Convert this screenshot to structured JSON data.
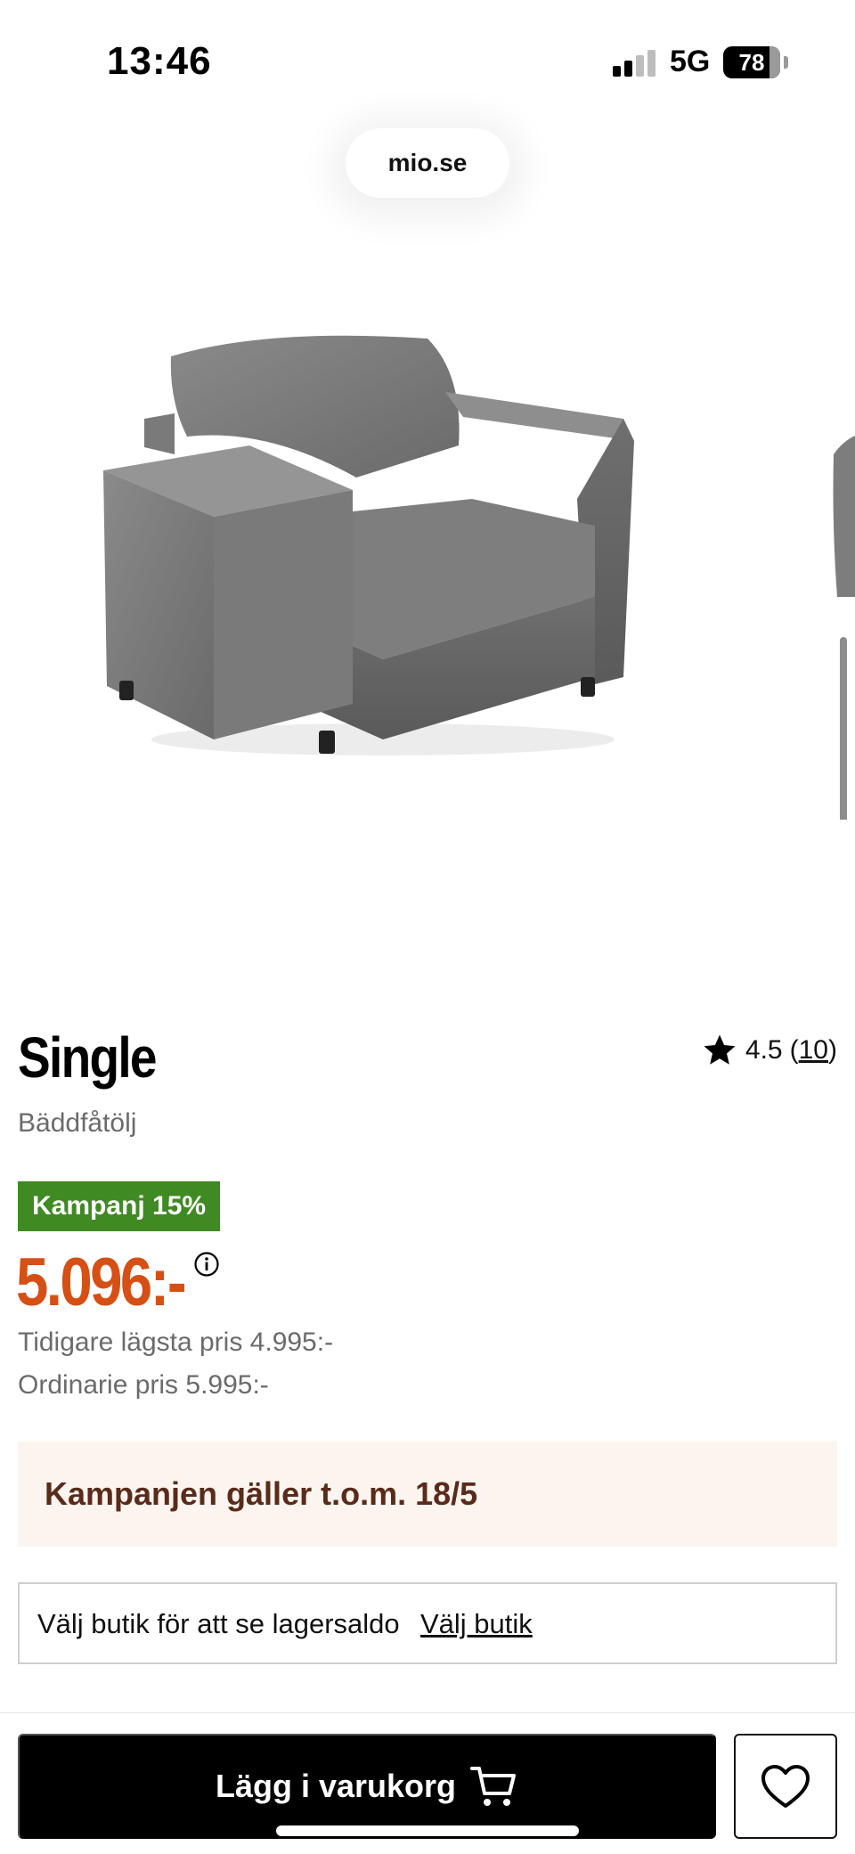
{
  "status_bar": {
    "time": "13:46",
    "network": "5G",
    "battery": "78",
    "icons": [
      "signal-icon",
      "battery-icon"
    ]
  },
  "browser": {
    "url": "mio.se"
  },
  "product": {
    "title": "Single",
    "subtitle": "Bäddfåtölj",
    "rating_value": "4.5",
    "rating_count_open": "(",
    "rating_count": "10",
    "rating_count_close": ")",
    "promo_badge": "Kampanj 15%",
    "price": "5.096:-",
    "lowest_price": "Tidigare lägsta pris 4.995:-",
    "regular_price": "Ordinarie pris 5.995:-",
    "campaign_text": "Kampanjen gäller t.o.m. 18/5",
    "store_text": "Välj butik för att se lagersaldo",
    "store_link": "Välj butik"
  },
  "actions": {
    "add_to_cart": "Lägg i varukorg"
  },
  "colors": {
    "promo_green": "#3f8a23",
    "price_orange": "#d64f14",
    "campaign_bg": "#fcf5ef",
    "campaign_text": "#5a2a1a",
    "cta_black": "#000000"
  }
}
